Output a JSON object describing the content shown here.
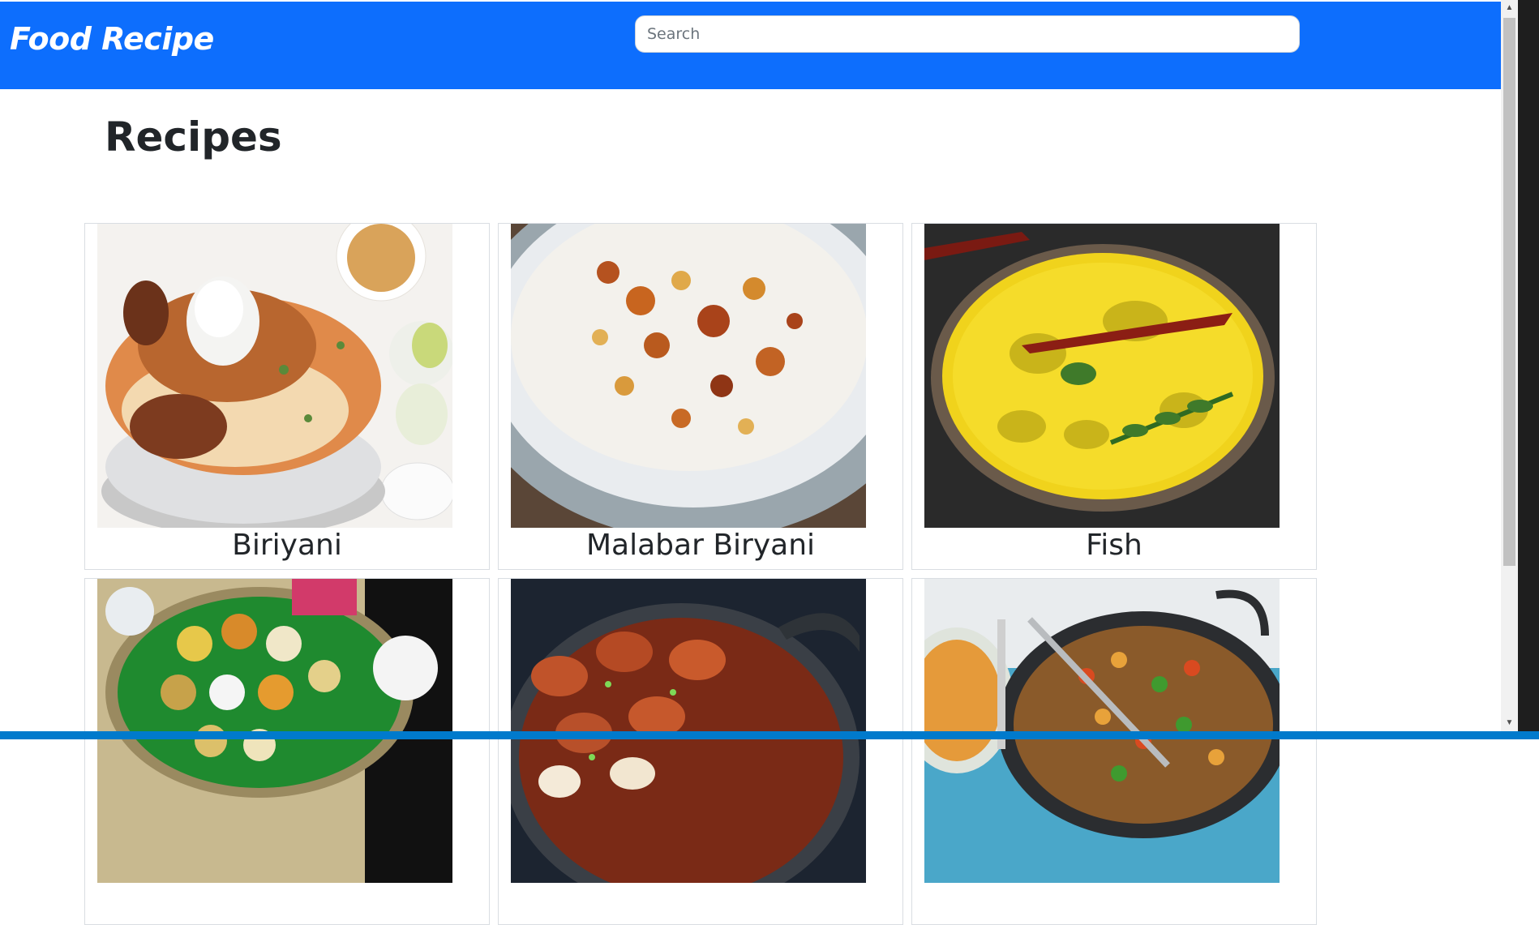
{
  "navbar": {
    "brand": "Food Recipe"
  },
  "search": {
    "placeholder": "Search",
    "value": ""
  },
  "page": {
    "title": "Recipes"
  },
  "recipes": [
    {
      "name": "Biriyani",
      "image": "biriyani-photo"
    },
    {
      "name": "Malabar Biryani",
      "image": "malabar-biryani-photo"
    },
    {
      "name": "Fish",
      "image": "fish-curry-photo"
    },
    {
      "name": "",
      "image": "thali-photo"
    },
    {
      "name": "",
      "image": "egg-curry-photo"
    },
    {
      "name": "",
      "image": "corn-stir-fry-photo"
    }
  ],
  "colors": {
    "navbar": "#0d6efd",
    "statusbar": "#007acc"
  }
}
